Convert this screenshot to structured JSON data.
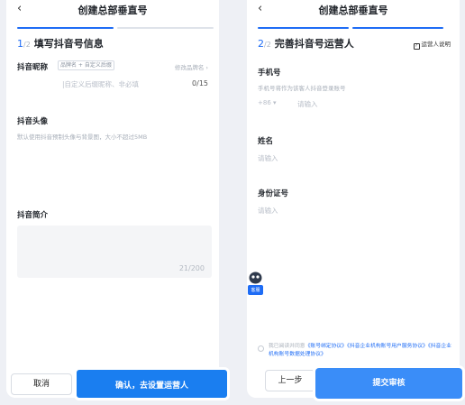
{
  "left": {
    "nav": {
      "back": "‹",
      "title": "创建总部垂直号"
    },
    "step": {
      "current": "1",
      "total": "/2",
      "title": "填写抖音号信息"
    },
    "nickname": {
      "label": "抖音昵称",
      "tag": "品牌名 + 自定义后缀",
      "rename_link": "修改品牌名 ›",
      "placeholder": "|自定义后缀昵称、非必填",
      "count": "0/15"
    },
    "avatar": {
      "label": "抖音头像",
      "hint": "默认使用抖音预制头像与背景图，大小不超过5MB"
    },
    "bio": {
      "label": "抖音简介",
      "count": "21/200"
    },
    "buttons": {
      "cancel": "取消",
      "confirm": "确认，去设置运营人"
    }
  },
  "right": {
    "nav": {
      "back": "‹",
      "title": "创建总部垂直号"
    },
    "step": {
      "current": "2",
      "total": "/2",
      "title": "完善抖音号运营人"
    },
    "guide": "运营人说明",
    "phone": {
      "label": "手机号",
      "hint": "手机号将作为该客人抖音登录账号",
      "prefix": "+86 ▾",
      "placeholder": "请输入"
    },
    "name": {
      "label": "姓名",
      "placeholder": "请输入"
    },
    "idcard": {
      "label": "身份证号",
      "placeholder": "请输入"
    },
    "agreement": {
      "prefix": "我已阅读并同意",
      "link1": "《账号绑定协议》",
      "link2": "《抖音企业机构账号用户服务协议》",
      "link3": "《抖音企业机构账号数据处理协议》"
    },
    "buttons": {
      "prev": "上一步",
      "submit": "提交审核"
    },
    "kefu_label": "客服"
  },
  "colors": {
    "accent": "#1e6cf5",
    "primary_button": "#1a7ef0"
  }
}
